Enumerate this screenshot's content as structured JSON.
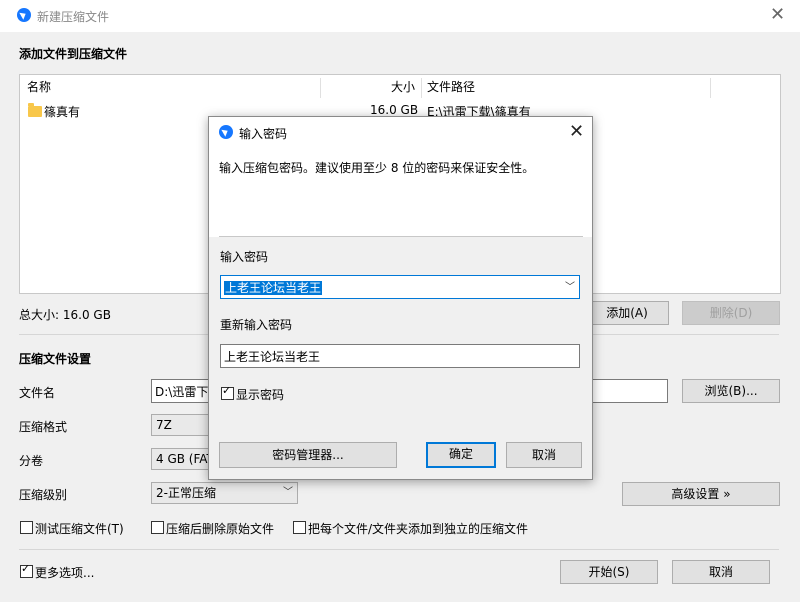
{
  "main": {
    "title": "新建压缩文件",
    "section_add": "添加文件到压缩文件",
    "columns": [
      "名称",
      "大小",
      "文件路径"
    ],
    "rows": [
      {
        "name": "篠真有",
        "size": "16.0 GB",
        "path": "E:\\迅雷下载\\篠真有"
      }
    ],
    "total_size": "总大小: 16.0 GB",
    "add_button": "添加(A)",
    "delete_button": "删除(D)",
    "settings_title": "压缩文件设置",
    "filename_label": "文件名",
    "filename_value": "D:\\迅雷下",
    "browse_button": "浏览(B)...",
    "format_label": "压缩格式",
    "format_value": "7Z",
    "volume_label": "分卷",
    "volume_value": "4 GB (FAT",
    "level_label": "压缩级别",
    "level_value": "2-正常压缩",
    "advanced_button": "高级设置 »",
    "opt_test": "测试压缩文件(T)",
    "opt_delete_source": "压缩后删除原始文件",
    "opt_separate": "把每个文件/文件夹添加到独立的压缩文件",
    "more_options": "更多选项...",
    "start_button": "开始(S)",
    "cancel_button": "取消"
  },
  "dialog": {
    "title": "输入密码",
    "hint": "输入压缩包密码。建议使用至少 8 位的密码来保证安全性。",
    "password_label": "输入密码",
    "password_value": "上老王论坛当老王",
    "reenter_label": "重新输入密码",
    "reenter_value": "上老王论坛当老王",
    "show_password": "显示密码",
    "manager_button": "密码管理器...",
    "ok_button": "确定",
    "cancel_button": "取消"
  }
}
